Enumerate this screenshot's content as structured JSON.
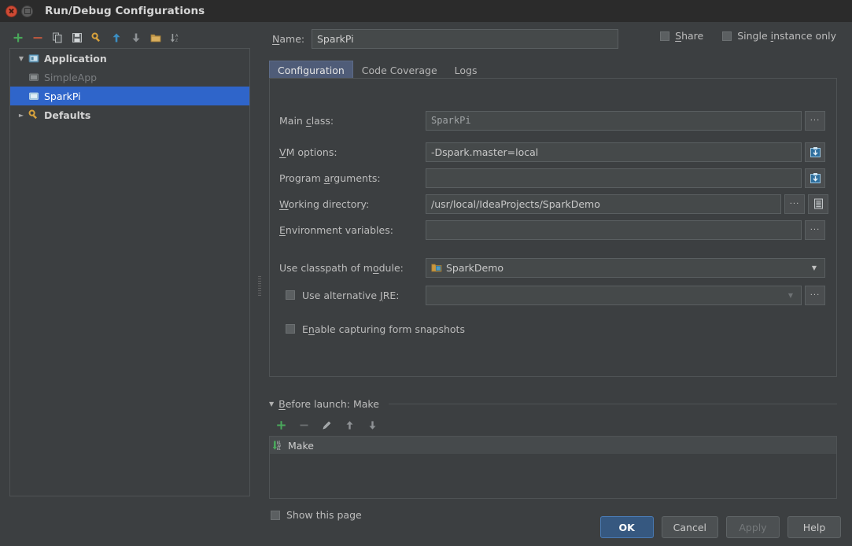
{
  "window": {
    "title": "Run/Debug Configurations",
    "close_icon": "close-icon",
    "maximize_icon": "maximize-icon"
  },
  "tree_toolbar": {
    "buttons": [
      {
        "name": "add-configuration-button",
        "icon": "plus-icon",
        "tooltip": "Add New Configuration"
      },
      {
        "name": "remove-configuration-button",
        "icon": "minus-icon",
        "tooltip": "Remove Configuration"
      },
      {
        "name": "copy-configuration-button",
        "icon": "copy-icon",
        "tooltip": "Copy Configuration"
      },
      {
        "name": "save-configuration-button",
        "icon": "save-icon",
        "tooltip": "Save Configuration"
      },
      {
        "name": "edit-defaults-button",
        "icon": "wrench-icon",
        "tooltip": "Edit defaults"
      },
      {
        "name": "move-up-button",
        "icon": "arrow-up-icon",
        "tooltip": "Move Up"
      },
      {
        "name": "move-down-button",
        "icon": "arrow-down-icon",
        "tooltip": "Move Down"
      },
      {
        "name": "new-folder-button",
        "icon": "folder-icon",
        "tooltip": "Create New Folder"
      },
      {
        "name": "sort-button",
        "icon": "sort-alpha-icon",
        "tooltip": "Sort Configurations"
      }
    ]
  },
  "tree": {
    "items": [
      {
        "label": "Application",
        "icon": "application-icon",
        "twisty": "expanded",
        "depth": 0,
        "state": "bold"
      },
      {
        "label": "SimpleApp",
        "icon": "run-config-icon",
        "twisty": "none",
        "depth": 1,
        "state": "dim"
      },
      {
        "label": "SparkPi",
        "icon": "run-config-icon",
        "twisty": "none",
        "depth": 1,
        "state": "selected"
      },
      {
        "label": "Defaults",
        "icon": "wrench-icon",
        "twisty": "collapsed",
        "depth": 0,
        "state": "bold"
      }
    ]
  },
  "name_row": {
    "label": "Name:",
    "mnemonic": "N",
    "value": "SparkPi"
  },
  "options": {
    "share": {
      "label": "Share",
      "mnemonic": "S",
      "checked": false
    },
    "single_instance": {
      "label": "Single instance only",
      "mnemonic": "i",
      "checked": false
    }
  },
  "tabs": [
    {
      "label": "Configuration",
      "active": true
    },
    {
      "label": "Code Coverage",
      "active": false
    },
    {
      "label": "Logs",
      "active": false
    }
  ],
  "form": {
    "main_class": {
      "label": "Main class:",
      "mnemonic": "c",
      "value": "SparkPi",
      "browse_label": "...",
      "browse_icon": "ellipsis-icon"
    },
    "vm_options": {
      "label": "VM options:",
      "mnemonic": "V",
      "value": "-Dspark.master=local",
      "expand_icon": "expand-editor-icon"
    },
    "program_arguments": {
      "label": "Program arguments:",
      "mnemonic": "a",
      "value": "",
      "expand_icon": "expand-editor-icon"
    },
    "working_directory": {
      "label": "Working directory:",
      "mnemonic": "W",
      "value": "/usr/local/IdeaProjects/SparkDemo",
      "browse_label": "...",
      "browse_icon": "ellipsis-icon",
      "macro_icon": "list-icon"
    },
    "environment_variables": {
      "label": "Environment variables:",
      "mnemonic": "E",
      "value": "",
      "browse_label": "...",
      "browse_icon": "ellipsis-icon"
    },
    "classpath_module": {
      "label": "Use classpath of module:",
      "mnemonic": "o",
      "value": "SparkDemo",
      "icon": "module-icon",
      "arrow_icon": "chevron-down-icon"
    },
    "alternative_jre": {
      "label": "Use alternative JRE:",
      "mnemonic": "J",
      "checked": false,
      "value": "",
      "arrow_icon": "chevron-down-icon",
      "browse_label": "...",
      "browse_icon": "ellipsis-icon"
    },
    "form_snapshots": {
      "label": "Enable capturing form snapshots",
      "mnemonic": "n",
      "checked": false
    }
  },
  "before_launch": {
    "title": "Before launch: Make",
    "mnemonic": "B",
    "twisty": "expanded",
    "toolbar": [
      {
        "name": "before-launch-add-button",
        "icon": "plus-icon"
      },
      {
        "name": "before-launch-remove-button",
        "icon": "minus-icon"
      },
      {
        "name": "before-launch-edit-button",
        "icon": "pencil-icon"
      },
      {
        "name": "before-launch-move-up-button",
        "icon": "arrow-up-icon"
      },
      {
        "name": "before-launch-move-down-button",
        "icon": "arrow-down-icon"
      }
    ],
    "tasks": [
      {
        "label": "Make",
        "icon": "compile-icon"
      }
    ]
  },
  "show_this_page": {
    "label": "Show this page",
    "checked": false
  },
  "buttons": {
    "ok": {
      "label": "OK",
      "style": "default"
    },
    "cancel": {
      "label": "Cancel",
      "style": "normal"
    },
    "apply": {
      "label": "Apply",
      "style": "disabled"
    },
    "help": {
      "label": "Help",
      "style": "normal"
    }
  },
  "colors": {
    "background": "#3c3f41",
    "titlebar": "#2b2b2b",
    "selection": "#2f65ca",
    "tab_active": "#4f5c78",
    "default_button": "#365880",
    "field_background": "#45494a",
    "border": "#4f5355",
    "accent_green": "#49a659",
    "accent_red": "#c75450",
    "accent_blue": "#3b8ec2"
  }
}
